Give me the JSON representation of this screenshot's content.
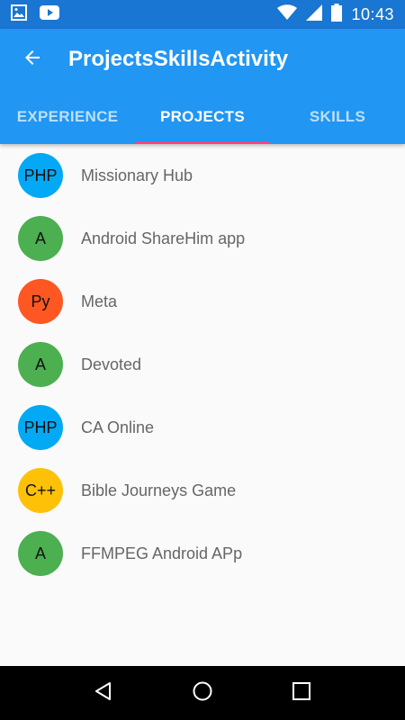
{
  "status_bar": {
    "time": "10:43",
    "left_icons": [
      "gallery-icon",
      "youtube-icon"
    ],
    "right_icons": [
      "wifi-icon",
      "signal-icon",
      "battery-icon"
    ]
  },
  "app_bar": {
    "back_icon": "arrow-back-icon",
    "title": "ProjectsSkillsActivity",
    "background_color": "#2196f3",
    "status_color": "#1976d2"
  },
  "tabs": [
    {
      "label": "EXPERIENCE",
      "active": false
    },
    {
      "label": "PROJECTS",
      "active": true
    },
    {
      "label": "SKILLS",
      "active": false
    }
  ],
  "tab_indicator_color": "#ff4081",
  "projects": [
    {
      "badge": "PHP",
      "name": "Missionary Hub",
      "color": "#03a9f4"
    },
    {
      "badge": "A",
      "name": "Android ShareHim app",
      "color": "#4caf50"
    },
    {
      "badge": "Py",
      "name": "Meta",
      "color": "#ff5722"
    },
    {
      "badge": "A",
      "name": "Devoted",
      "color": "#4caf50"
    },
    {
      "badge": "PHP",
      "name": "CA Online",
      "color": "#03a9f4"
    },
    {
      "badge": "C++",
      "name": "Bible Journeys Game",
      "color": "#ffc107"
    },
    {
      "badge": "A",
      "name": "FFMPEG Android APp",
      "color": "#4caf50"
    }
  ],
  "nav_bar": {
    "buttons": [
      "back-triangle-icon",
      "home-circle-icon",
      "recents-square-icon"
    ]
  }
}
